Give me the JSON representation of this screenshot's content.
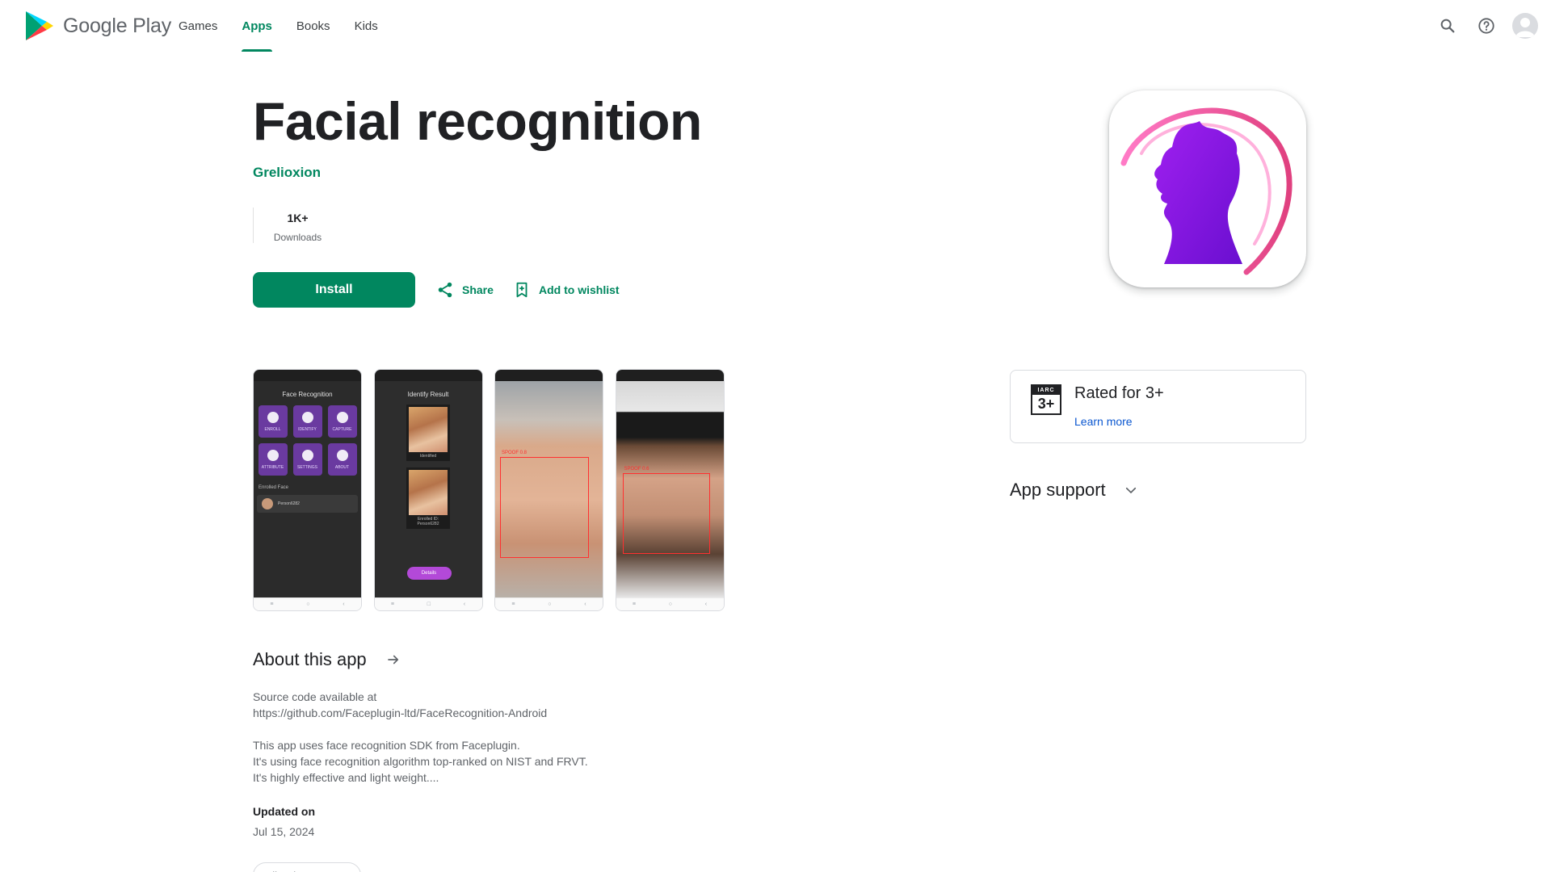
{
  "header": {
    "brand": "Google Play",
    "nav": [
      {
        "label": "Games",
        "active": false
      },
      {
        "label": "Apps",
        "active": true
      },
      {
        "label": "Books",
        "active": false
      },
      {
        "label": "Kids",
        "active": false
      }
    ],
    "icons": [
      "search-icon",
      "help-icon",
      "account-avatar"
    ]
  },
  "app": {
    "title": "Facial recognition",
    "developer": "Grelioxion",
    "downloads_value": "1K+",
    "downloads_label": "Downloads",
    "install_label": "Install",
    "share_label": "Share",
    "wishlist_label": "Add to wishlist"
  },
  "screenshots": {
    "shot1": {
      "title": "Face Recognition",
      "tiles": [
        "ENROLL",
        "IDENTIFY",
        "CAPTURE",
        "ATTRIBUTE",
        "SETTINGS",
        "ABOUT"
      ],
      "enrolled_label": "Enrolled Face",
      "enrolled_name": "Person6282"
    },
    "shot2": {
      "title": "Identify Result",
      "card1_caption": "Identified",
      "card2_caption": "Enrolled ID: Person6282",
      "details_label": "Details"
    },
    "shot3": {
      "label": "SPOOF 0.8"
    },
    "shot4": {
      "label": "SPOOF 0.6"
    }
  },
  "about": {
    "title": "About this app",
    "para1_line1": "Source code available at",
    "para1_line2": "https://github.com/Faceplugin-ltd/FaceRecognition-Android",
    "para2_line1": "This app uses face recognition SDK from Faceplugin.",
    "para2_line2": "It's using face recognition algorithm top-ranked on NIST and FRVT.",
    "para2_line3": "It's highly effective and light weight....",
    "updated_label": "Updated on",
    "updated_value": "Jul 15, 2024",
    "category_chip": "Libraries & Demo"
  },
  "rating": {
    "badge_top": "IARC",
    "badge_value": "3+",
    "title": "Rated for 3+",
    "link": "Learn more"
  },
  "support": {
    "title": "App support"
  },
  "colors": {
    "accent": "#01875f",
    "link": "#0b57d0",
    "text": "#202124",
    "muted": "#5f6368"
  }
}
